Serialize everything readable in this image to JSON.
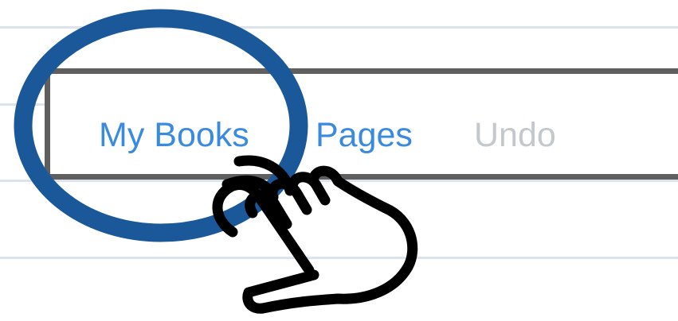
{
  "toolbar": {
    "my_books_label": "My Books",
    "pages_label": "Pages",
    "undo_label": "Undo"
  },
  "annotation": {
    "highlight_icon": "highlight-circle",
    "pointer_icon": "tap-hand-icon"
  },
  "colors": {
    "accent": "#3a8ae0",
    "disabled": "#c3c8cd",
    "highlight": "#1b5899",
    "rule": "#dbe4ec"
  }
}
